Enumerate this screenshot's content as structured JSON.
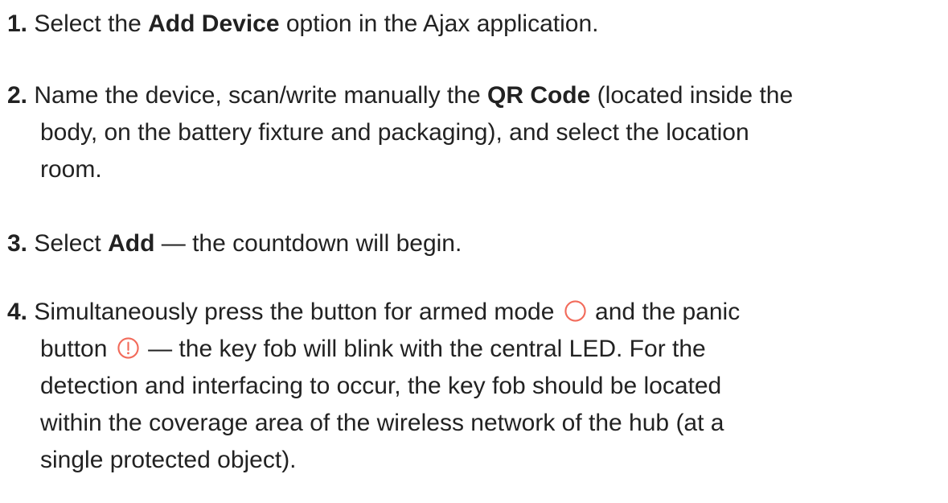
{
  "steps": [
    {
      "num": "1.",
      "t1": "Select the ",
      "b1": "Add Device",
      "t2": " option in the Ajax application."
    },
    {
      "num": "2.",
      "t1": "Name the device, scan/write manually the ",
      "b1": "QR Code",
      "t2": " (located inside the",
      "l2": "body, on the battery fixture and packaging), and select the location",
      "l3": "room."
    },
    {
      "num": "3.",
      "t1": "Select ",
      "b1": "Add",
      "t2": " — the countdown will begin."
    },
    {
      "num": "4.",
      "t1": "Simultaneously press the button for armed mode ",
      "icon1": "armed-mode-circle-icon",
      "t2": " and the panic",
      "t3": "button ",
      "icon2": "panic-exclamation-icon",
      "t4": " — the key fob will blink with the central LED. For the",
      "l3": "detection and interfacing to occur, the key fob should be located",
      "l4": "within the coverage area of the wireless network of the hub (at a",
      "l5": "single protected object)."
    }
  ],
  "colors": {
    "text": "#222222",
    "icon": "#f26b5b"
  }
}
